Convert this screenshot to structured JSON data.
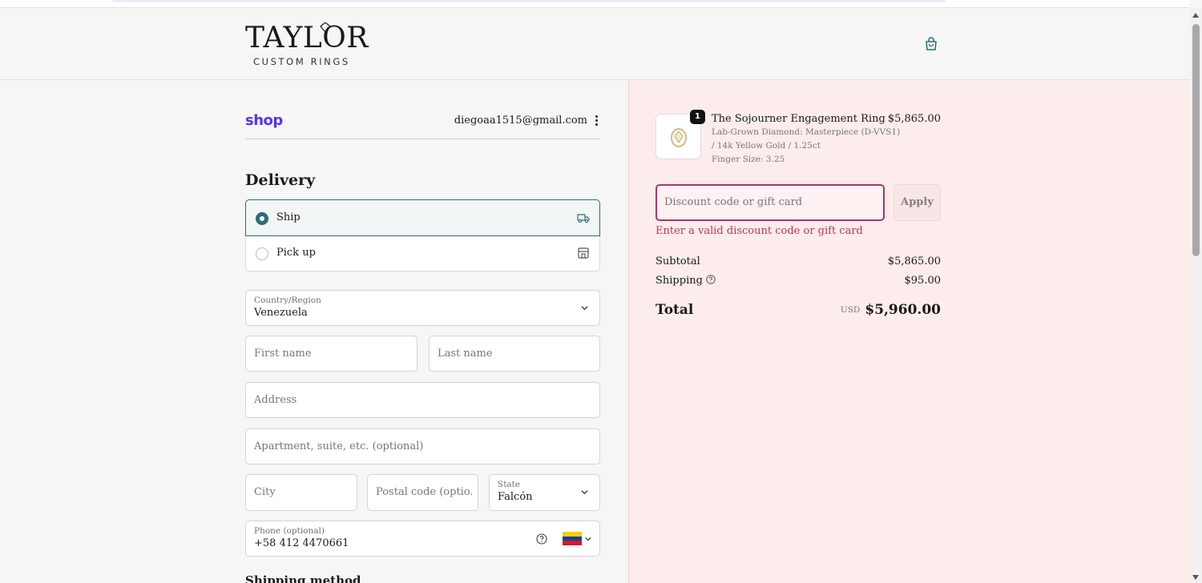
{
  "brand": {
    "name": "TAYLOR",
    "tagline": "CUSTOM RINGS"
  },
  "shop_pay": {
    "logo_text": "shop",
    "email": "diegoaa1515@gmail.com"
  },
  "delivery": {
    "heading": "Delivery",
    "options": [
      {
        "label": "Ship",
        "selected": true,
        "icon": "truck-icon"
      },
      {
        "label": "Pick up",
        "selected": false,
        "icon": "store-icon"
      }
    ]
  },
  "form": {
    "country_label": "Country/Region",
    "country_value": "Venezuela",
    "first_name_placeholder": "First name",
    "last_name_placeholder": "Last name",
    "address_placeholder": "Address",
    "apartment_placeholder": "Apartment, suite, etc. (optional)",
    "city_placeholder": "City",
    "postal_placeholder": "Postal code (optio...",
    "state_label": "State",
    "state_value": "Falcón",
    "phone_label": "Phone (optional)",
    "phone_value": "+58 412 4470661"
  },
  "shipping_method_heading": "Shipping method",
  "order": {
    "quantity": "1",
    "product_name": "The Sojourner Engagement Ring",
    "product_variant_line1": "Lab-Grown Diamond: Masterpiece (D-VVS1)",
    "product_variant_line2": "/ 14k Yellow Gold / 1.25ct",
    "product_finger_size": "Finger Size: 3.25",
    "product_price": "$5,865.00"
  },
  "discount": {
    "placeholder": "Discount code or gift card",
    "apply_label": "Apply",
    "error": "Enter a valid discount code or gift card"
  },
  "summary": {
    "subtotal_label": "Subtotal",
    "subtotal_value": "$5,865.00",
    "shipping_label": "Shipping",
    "shipping_value": "$95.00",
    "total_label": "Total",
    "currency": "USD",
    "total_value": "$5,960.00"
  },
  "colors": {
    "accent": "#2b6c76",
    "shop_purple": "#5a31f4",
    "error": "#c2325d",
    "summary_bg": "#fcecec"
  }
}
